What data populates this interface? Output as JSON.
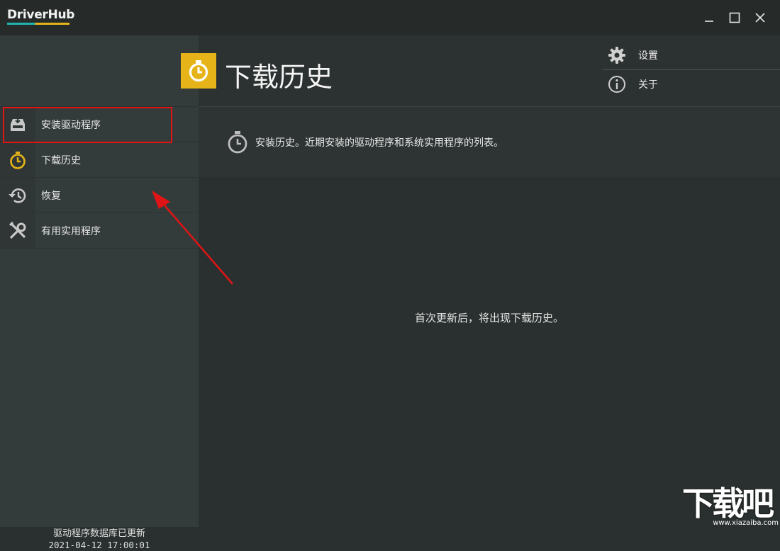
{
  "app": {
    "title": "DriverHub"
  },
  "window_controls": {
    "minimize": "minimize-icon",
    "maximize": "maximize-icon",
    "close": "close-icon"
  },
  "sidebar": {
    "items": [
      {
        "label": "安装驱动程序",
        "icon": "install-tray-icon"
      },
      {
        "label": "下载历史",
        "icon": "stopwatch-icon"
      },
      {
        "label": "恢复",
        "icon": "history-restore-icon"
      },
      {
        "label": "有用实用程序",
        "icon": "tools-icon"
      }
    ],
    "active_index": 1,
    "db_status": "驱动程序数据库已更新",
    "db_time": "2021-04-12 17:00:01"
  },
  "header": {
    "title": "下载历史"
  },
  "topmenu": {
    "settings": "设置",
    "about": "关于"
  },
  "description": "安装历史。近期安装的驱动程序和系统实用程序的列表。",
  "main": {
    "empty_message": "首次更新后，将出现下载历史。"
  },
  "watermark": {
    "text": "下载吧",
    "url": "www.xiazaiba.com"
  },
  "colors": {
    "accent": "#e6b418",
    "highlight": "#e01414",
    "sidebar": "#343c3b",
    "background": "#2a302f"
  }
}
